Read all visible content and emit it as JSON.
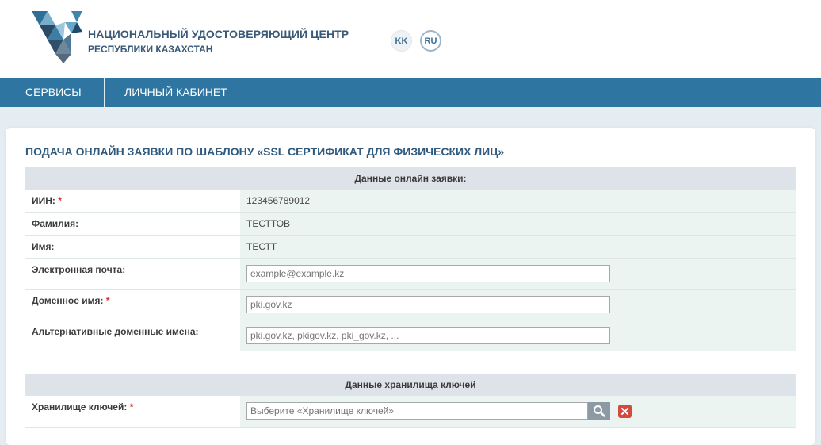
{
  "header": {
    "org_name": "НАЦИОНАЛЬНЫЙ УДОСТОВЕРЯЮЩИЙ ЦЕНТР",
    "org_sub": "РЕСПУБЛИКИ КАЗАХСТАН",
    "languages": [
      {
        "code": "KK"
      },
      {
        "code": "RU"
      }
    ]
  },
  "nav": {
    "items": [
      {
        "label": "СЕРВИСЫ"
      },
      {
        "label": "ЛИЧНЫЙ КАБИНЕТ"
      }
    ]
  },
  "page": {
    "title": "ПОДАЧА ОНЛАЙН ЗАЯВКИ ПО ШАБЛОНУ «SSL СЕРТИФИКАТ ДЛЯ ФИЗИЧЕСКИХ ЛИЦ»"
  },
  "section1": {
    "heading": "Данные онлайн заявки:",
    "rows": [
      {
        "label": "ИИН:",
        "required": "*",
        "value": "123456789012"
      },
      {
        "label": "Фамилия:",
        "value": "ТЕСТТОВ"
      },
      {
        "label": "Имя:",
        "value": "ТЕСТТ"
      },
      {
        "label": "Электронная почта:",
        "placeholder": "example@example.kz"
      },
      {
        "label": "Доменное имя:",
        "required": "*",
        "placeholder": "pki.gov.kz"
      },
      {
        "label": "Альтернативные доменные имена:",
        "placeholder": "pki.gov.kz, pkigov.kz, pki_gov.kz, ..."
      }
    ]
  },
  "section2": {
    "heading": "Данные хранилища ключей",
    "rows": [
      {
        "label": "Хранилище ключей:",
        "required": "*",
        "placeholder": "Выберите «Хранилище ключей»"
      }
    ]
  },
  "colors": {
    "nav_bg": "#2e75a1",
    "title": "#2f5a7e",
    "value_bg": "#ecf4f2",
    "section_bg": "#dde3e8",
    "required": "#d0342c",
    "clear_btn": "#d34b3f"
  }
}
